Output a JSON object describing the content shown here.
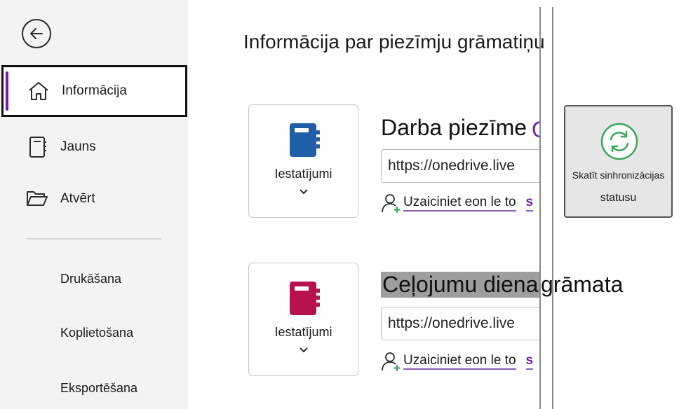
{
  "sidebar": {
    "back_label": "",
    "nav": [
      {
        "label": "Informācija",
        "icon": "home-icon",
        "selected": true
      },
      {
        "label": "Jauns",
        "icon": "new-notebook-icon"
      },
      {
        "label": "Atvērt",
        "icon": "folder-open-icon"
      }
    ],
    "text_items": [
      "Drukāšana",
      "Koplietošana",
      "Eksportēšana"
    ]
  },
  "main": {
    "title": "Informācija par piezīmju grāmatiņu",
    "notebooks": [
      {
        "name_visible": "Darba piezīme",
        "color": "#1f5fa8",
        "settings_label": "Iestatījumi",
        "url": "https://onedrive.live",
        "invite_label": "Uzaiciniet eon le to",
        "invite_link_char": "s"
      },
      {
        "name_visible": "Ceļojumu dienas",
        "name_overflow": "grāmata",
        "color": "#b5124e",
        "settings_label": "Iestatījumi",
        "url": "https://onedrive.live",
        "invite_label": "Uzaiciniet eon le to",
        "invite_link_char": "s"
      }
    ],
    "sync_tile": {
      "line1": "Skatīt sinhronizācijas",
      "line2": "statusu",
      "icon": "sync-icon"
    }
  },
  "colors": {
    "accent": "#7719aa",
    "sync_green": "#3aa757"
  }
}
